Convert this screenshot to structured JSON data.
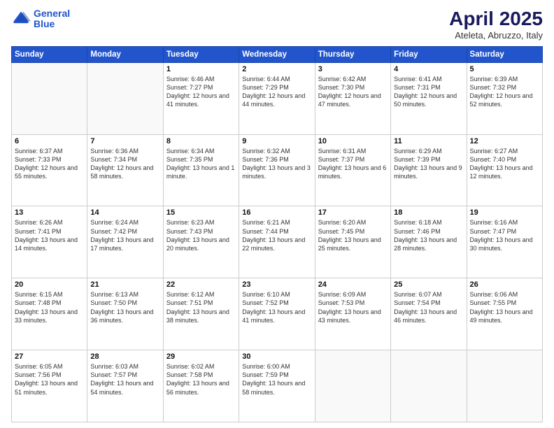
{
  "header": {
    "logo_line1": "General",
    "logo_line2": "Blue",
    "month": "April 2025",
    "location": "Ateleta, Abruzzo, Italy"
  },
  "days_of_week": [
    "Sunday",
    "Monday",
    "Tuesday",
    "Wednesday",
    "Thursday",
    "Friday",
    "Saturday"
  ],
  "weeks": [
    [
      {
        "day": "",
        "sunrise": "",
        "sunset": "",
        "daylight": ""
      },
      {
        "day": "",
        "sunrise": "",
        "sunset": "",
        "daylight": ""
      },
      {
        "day": "1",
        "sunrise": "Sunrise: 6:46 AM",
        "sunset": "Sunset: 7:27 PM",
        "daylight": "Daylight: 12 hours and 41 minutes."
      },
      {
        "day": "2",
        "sunrise": "Sunrise: 6:44 AM",
        "sunset": "Sunset: 7:29 PM",
        "daylight": "Daylight: 12 hours and 44 minutes."
      },
      {
        "day": "3",
        "sunrise": "Sunrise: 6:42 AM",
        "sunset": "Sunset: 7:30 PM",
        "daylight": "Daylight: 12 hours and 47 minutes."
      },
      {
        "day": "4",
        "sunrise": "Sunrise: 6:41 AM",
        "sunset": "Sunset: 7:31 PM",
        "daylight": "Daylight: 12 hours and 50 minutes."
      },
      {
        "day": "5",
        "sunrise": "Sunrise: 6:39 AM",
        "sunset": "Sunset: 7:32 PM",
        "daylight": "Daylight: 12 hours and 52 minutes."
      }
    ],
    [
      {
        "day": "6",
        "sunrise": "Sunrise: 6:37 AM",
        "sunset": "Sunset: 7:33 PM",
        "daylight": "Daylight: 12 hours and 55 minutes."
      },
      {
        "day": "7",
        "sunrise": "Sunrise: 6:36 AM",
        "sunset": "Sunset: 7:34 PM",
        "daylight": "Daylight: 12 hours and 58 minutes."
      },
      {
        "day": "8",
        "sunrise": "Sunrise: 6:34 AM",
        "sunset": "Sunset: 7:35 PM",
        "daylight": "Daylight: 13 hours and 1 minute."
      },
      {
        "day": "9",
        "sunrise": "Sunrise: 6:32 AM",
        "sunset": "Sunset: 7:36 PM",
        "daylight": "Daylight: 13 hours and 3 minutes."
      },
      {
        "day": "10",
        "sunrise": "Sunrise: 6:31 AM",
        "sunset": "Sunset: 7:37 PM",
        "daylight": "Daylight: 13 hours and 6 minutes."
      },
      {
        "day": "11",
        "sunrise": "Sunrise: 6:29 AM",
        "sunset": "Sunset: 7:39 PM",
        "daylight": "Daylight: 13 hours and 9 minutes."
      },
      {
        "day": "12",
        "sunrise": "Sunrise: 6:27 AM",
        "sunset": "Sunset: 7:40 PM",
        "daylight": "Daylight: 13 hours and 12 minutes."
      }
    ],
    [
      {
        "day": "13",
        "sunrise": "Sunrise: 6:26 AM",
        "sunset": "Sunset: 7:41 PM",
        "daylight": "Daylight: 13 hours and 14 minutes."
      },
      {
        "day": "14",
        "sunrise": "Sunrise: 6:24 AM",
        "sunset": "Sunset: 7:42 PM",
        "daylight": "Daylight: 13 hours and 17 minutes."
      },
      {
        "day": "15",
        "sunrise": "Sunrise: 6:23 AM",
        "sunset": "Sunset: 7:43 PM",
        "daylight": "Daylight: 13 hours and 20 minutes."
      },
      {
        "day": "16",
        "sunrise": "Sunrise: 6:21 AM",
        "sunset": "Sunset: 7:44 PM",
        "daylight": "Daylight: 13 hours and 22 minutes."
      },
      {
        "day": "17",
        "sunrise": "Sunrise: 6:20 AM",
        "sunset": "Sunset: 7:45 PM",
        "daylight": "Daylight: 13 hours and 25 minutes."
      },
      {
        "day": "18",
        "sunrise": "Sunrise: 6:18 AM",
        "sunset": "Sunset: 7:46 PM",
        "daylight": "Daylight: 13 hours and 28 minutes."
      },
      {
        "day": "19",
        "sunrise": "Sunrise: 6:16 AM",
        "sunset": "Sunset: 7:47 PM",
        "daylight": "Daylight: 13 hours and 30 minutes."
      }
    ],
    [
      {
        "day": "20",
        "sunrise": "Sunrise: 6:15 AM",
        "sunset": "Sunset: 7:48 PM",
        "daylight": "Daylight: 13 hours and 33 minutes."
      },
      {
        "day": "21",
        "sunrise": "Sunrise: 6:13 AM",
        "sunset": "Sunset: 7:50 PM",
        "daylight": "Daylight: 13 hours and 36 minutes."
      },
      {
        "day": "22",
        "sunrise": "Sunrise: 6:12 AM",
        "sunset": "Sunset: 7:51 PM",
        "daylight": "Daylight: 13 hours and 38 minutes."
      },
      {
        "day": "23",
        "sunrise": "Sunrise: 6:10 AM",
        "sunset": "Sunset: 7:52 PM",
        "daylight": "Daylight: 13 hours and 41 minutes."
      },
      {
        "day": "24",
        "sunrise": "Sunrise: 6:09 AM",
        "sunset": "Sunset: 7:53 PM",
        "daylight": "Daylight: 13 hours and 43 minutes."
      },
      {
        "day": "25",
        "sunrise": "Sunrise: 6:07 AM",
        "sunset": "Sunset: 7:54 PM",
        "daylight": "Daylight: 13 hours and 46 minutes."
      },
      {
        "day": "26",
        "sunrise": "Sunrise: 6:06 AM",
        "sunset": "Sunset: 7:55 PM",
        "daylight": "Daylight: 13 hours and 49 minutes."
      }
    ],
    [
      {
        "day": "27",
        "sunrise": "Sunrise: 6:05 AM",
        "sunset": "Sunset: 7:56 PM",
        "daylight": "Daylight: 13 hours and 51 minutes."
      },
      {
        "day": "28",
        "sunrise": "Sunrise: 6:03 AM",
        "sunset": "Sunset: 7:57 PM",
        "daylight": "Daylight: 13 hours and 54 minutes."
      },
      {
        "day": "29",
        "sunrise": "Sunrise: 6:02 AM",
        "sunset": "Sunset: 7:58 PM",
        "daylight": "Daylight: 13 hours and 56 minutes."
      },
      {
        "day": "30",
        "sunrise": "Sunrise: 6:00 AM",
        "sunset": "Sunset: 7:59 PM",
        "daylight": "Daylight: 13 hours and 58 minutes."
      },
      {
        "day": "",
        "sunrise": "",
        "sunset": "",
        "daylight": ""
      },
      {
        "day": "",
        "sunrise": "",
        "sunset": "",
        "daylight": ""
      },
      {
        "day": "",
        "sunrise": "",
        "sunset": "",
        "daylight": ""
      }
    ]
  ]
}
